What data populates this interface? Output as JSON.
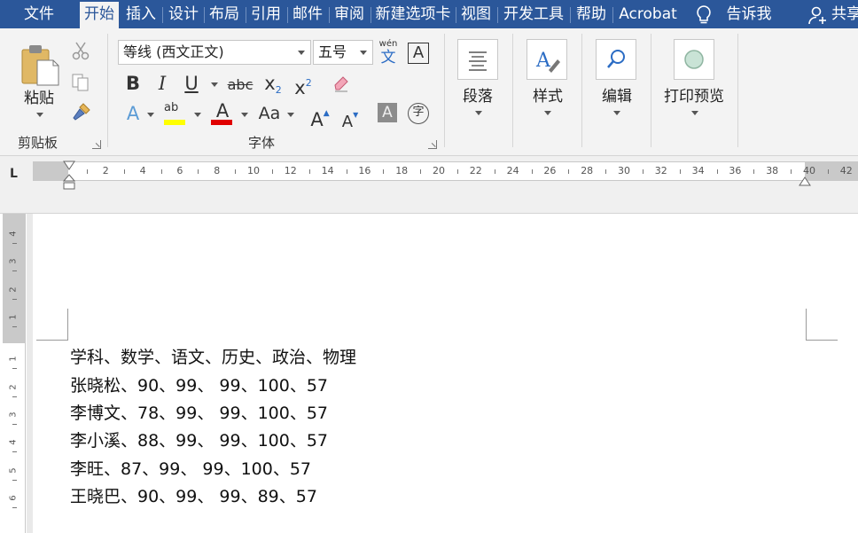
{
  "menu": {
    "tabs": [
      "文件",
      "开始",
      "插入",
      "设计",
      "布局",
      "引用",
      "邮件",
      "审阅",
      "新建选项卡",
      "视图",
      "开发工具",
      "帮助",
      "Acrobat"
    ],
    "active_tab": "开始",
    "tell_me": "告诉我",
    "share": "共享"
  },
  "ribbon": {
    "clipboard": {
      "paste_label": "粘贴",
      "group_label": "剪贴板"
    },
    "font": {
      "font_name": "等线 (西文正文)",
      "font_size": "五号",
      "phonetic_label": "wén",
      "phonetic_char": "文",
      "border_char": "A",
      "bold": "B",
      "italic": "I",
      "underline": "U",
      "strike": "abc",
      "subscript": "x",
      "subscript_mark": "2",
      "superscript": "x",
      "superscript_mark": "2",
      "effects": "A",
      "highlight": "ab",
      "font_color": "A",
      "change_case": "Aa",
      "grow": "A",
      "shrink": "A",
      "shading": "A",
      "enclose": "字",
      "group_label": "字体",
      "highlight_color": "#ffff00",
      "font_color_value": "#e00000"
    },
    "paragraph_label": "段落",
    "styles_label": "样式",
    "edit_label": "编辑",
    "print_preview_label": "打印预览"
  },
  "ruler": {
    "tab_stop": "L",
    "numbers": [
      "2",
      "4",
      "6",
      "8",
      "10",
      "12",
      "14",
      "16",
      "18",
      "20",
      "22",
      "24",
      "26",
      "28",
      "30",
      "32",
      "34",
      "36",
      "38",
      "40",
      "42"
    ],
    "vertical_numbers": [
      "4",
      "3",
      "2",
      "1",
      "1",
      "2",
      "3",
      "4",
      "5",
      "6"
    ]
  },
  "document": {
    "lines": [
      "学科、数学、语文、历史、政治、物理",
      "张晓松、90、99、 99、100、57",
      "李博文、78、99、 99、100、57",
      "李小溪、88、99、 99、100、57",
      "李旺、87、99、 99、100、57",
      "王晓巴、90、99、 99、89、57"
    ]
  },
  "colors": {
    "ribbon_blue": "#2b579a",
    "ribbon_bg": "#f3f3f3"
  }
}
